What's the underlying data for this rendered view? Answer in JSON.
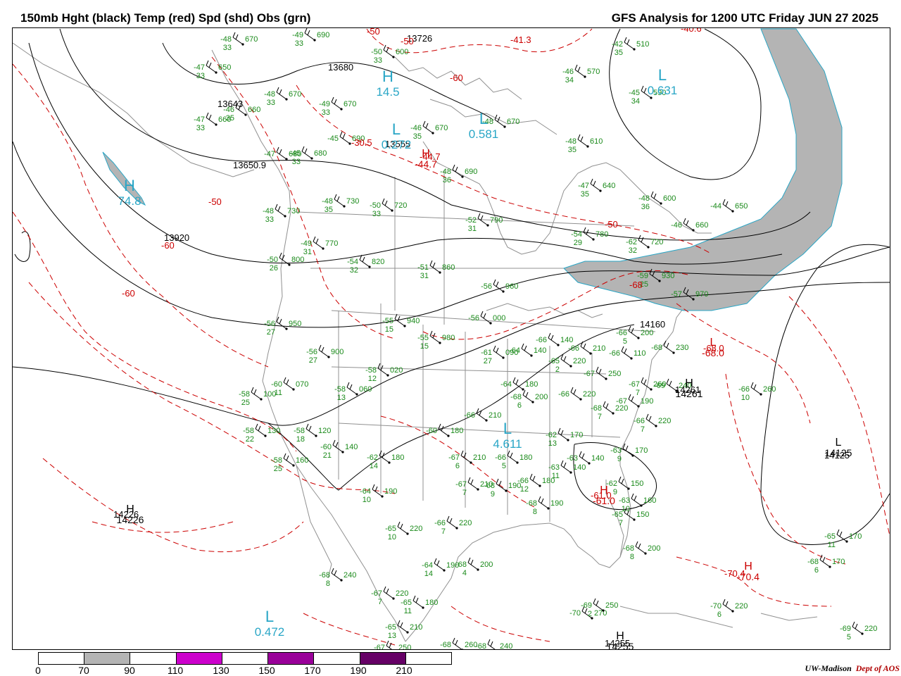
{
  "header": {
    "title_left": "150mb Hght (black) Temp (red) Spd (shd) Obs (grn)",
    "title_right": "GFS Analysis for 1200 UTC Friday  JUN 27 2025"
  },
  "colors": {
    "height_contour": "#000000",
    "temperature_contour": "#cc0000",
    "speed_shading": "#b4b4b4",
    "observation": "#1a8a1a",
    "high_low_marker": "#29a6c6",
    "geography": "#909090"
  },
  "height_labels": [
    "13726",
    "13680",
    "13643",
    "13555",
    "13650.9",
    "13920",
    "14226",
    "14261",
    "14160",
    "14125",
    "14255"
  ],
  "temperature_labels": [
    "-50",
    "-50",
    "-50",
    "-50",
    "-60",
    "-60",
    "-60",
    "-68",
    "-68.0",
    "-61.0",
    "-70.4",
    "-40.6",
    "-41.3",
    "-44.7",
    "-30.5"
  ],
  "pressure_centers": [
    {
      "letter": "H",
      "value": "14.5",
      "color": "cyan"
    },
    {
      "letter": "L",
      "value": "0.631",
      "color": "cyan"
    },
    {
      "letter": "L",
      "value": "0.272",
      "color": "cyan"
    },
    {
      "letter": "L",
      "value": "0.581",
      "color": "cyan"
    },
    {
      "letter": "H",
      "value": "74.8",
      "color": "cyan"
    },
    {
      "letter": "L",
      "value": "4.611",
      "color": "cyan"
    },
    {
      "letter": "L",
      "value": "0.472",
      "color": "cyan"
    },
    {
      "letter": "H",
      "value": "14226",
      "color": "black"
    },
    {
      "letter": "H",
      "value": "14261",
      "color": "black"
    },
    {
      "letter": "L",
      "value": "14125",
      "color": "black"
    },
    {
      "letter": "H",
      "value": "14255",
      "color": "black"
    },
    {
      "letter": "H",
      "value": "-61.0",
      "color": "red"
    },
    {
      "letter": "H",
      "value": "-44.7",
      "color": "red"
    },
    {
      "letter": "L",
      "value": "-68.0",
      "color": "red"
    },
    {
      "letter": "H",
      "value": "-70.4",
      "color": "red"
    }
  ],
  "observations": [
    {
      "t": "-48",
      "h": "670",
      "d": "33"
    },
    {
      "t": "-49",
      "h": "690",
      "d": "33"
    },
    {
      "t": "-47",
      "h": "650",
      "d": "33"
    },
    {
      "t": "-48",
      "h": "670",
      "d": "33"
    },
    {
      "t": "-46",
      "h": "660",
      "d": "35"
    },
    {
      "t": "-47",
      "h": "660",
      "d": "33"
    },
    {
      "t": "-49",
      "h": "670",
      "d": "33"
    },
    {
      "t": "-46",
      "h": "670",
      "d": "35"
    },
    {
      "t": "-48",
      "h": "670",
      "d": ""
    },
    {
      "t": "-48",
      "h": "690",
      "d": "36"
    },
    {
      "t": "-48",
      "h": "730",
      "d": "35"
    },
    {
      "t": "-50",
      "h": "720",
      "d": "33"
    },
    {
      "t": "-48",
      "h": "730",
      "d": "33"
    },
    {
      "t": "-49",
      "h": "770",
      "d": "31"
    },
    {
      "t": "-50",
      "h": "800",
      "d": "26"
    },
    {
      "t": "-54",
      "h": "820",
      "d": "32"
    },
    {
      "t": "-51",
      "h": "860",
      "d": "31"
    },
    {
      "t": "-56",
      "h": "960",
      "d": ""
    },
    {
      "t": "-56",
      "h": "000",
      "d": ""
    },
    {
      "t": "-55",
      "h": "980",
      "d": "15"
    },
    {
      "t": "-55",
      "h": "940",
      "d": "15"
    },
    {
      "t": "-56",
      "h": "950",
      "d": "27"
    },
    {
      "t": "-56",
      "h": "900",
      "d": "27"
    },
    {
      "t": "-58",
      "h": "020",
      "d": "12"
    },
    {
      "t": "-58",
      "h": "060",
      "d": "13"
    },
    {
      "t": "-60",
      "h": "070",
      "d": "11"
    },
    {
      "t": "-58",
      "h": "100",
      "d": "25"
    },
    {
      "t": "-58",
      "h": "130",
      "d": "22"
    },
    {
      "t": "-58",
      "h": "120",
      "d": "18"
    },
    {
      "t": "-60",
      "h": "140",
      "d": "21"
    },
    {
      "t": "-58",
      "h": "160",
      "d": "25"
    },
    {
      "t": "-62",
      "h": "180",
      "d": "14"
    },
    {
      "t": "-64",
      "h": "190",
      "d": "10"
    },
    {
      "t": "-60",
      "h": "180",
      "d": ""
    },
    {
      "t": "-66",
      "h": "210",
      "d": ""
    },
    {
      "t": "-67",
      "h": "210",
      "d": "6"
    },
    {
      "t": "-67",
      "h": "210",
      "d": "7"
    },
    {
      "t": "-68",
      "h": "190",
      "d": "9"
    },
    {
      "t": "-66",
      "h": "180",
      "d": "5"
    },
    {
      "t": "-66",
      "h": "180",
      "d": "12"
    },
    {
      "t": "-64",
      "h": "180",
      "d": ""
    },
    {
      "t": "-68",
      "h": "200",
      "d": "6"
    },
    {
      "t": "-65",
      "h": "220",
      "d": "10"
    },
    {
      "t": "-66",
      "h": "220",
      "d": "7"
    },
    {
      "t": "-64",
      "h": "190",
      "d": "14"
    },
    {
      "t": "-68",
      "h": "200",
      "d": "4"
    },
    {
      "t": "-68",
      "h": "240",
      "d": "8"
    },
    {
      "t": "-67",
      "h": "220",
      "d": "7"
    },
    {
      "t": "-65",
      "h": "180",
      "d": "11"
    },
    {
      "t": "-65",
      "h": "210",
      "d": "13"
    },
    {
      "t": "-67",
      "h": "250",
      "d": ""
    },
    {
      "t": "-68",
      "h": "260",
      "d": ""
    },
    {
      "t": "-68",
      "h": "240",
      "d": ""
    },
    {
      "t": "-61",
      "h": "090",
      "d": "27"
    },
    {
      "t": "-64",
      "h": "140",
      "d": ""
    },
    {
      "t": "-66",
      "h": "140",
      "d": ""
    },
    {
      "t": "-65",
      "h": "220",
      "d": "2"
    },
    {
      "t": "-66",
      "h": "210",
      "d": ""
    },
    {
      "t": "-67",
      "h": "250",
      "d": ""
    },
    {
      "t": "-66",
      "h": "220",
      "d": ""
    },
    {
      "t": "-68",
      "h": "220",
      "d": "7"
    },
    {
      "t": "-67",
      "h": "260",
      "d": "7"
    },
    {
      "t": "-69",
      "h": "240",
      "d": ""
    },
    {
      "t": "-66",
      "h": "200",
      "d": "5"
    },
    {
      "t": "-66",
      "h": "110",
      "d": ""
    },
    {
      "t": "-68",
      "h": "230",
      "d": ""
    },
    {
      "t": "-62",
      "h": "170",
      "d": "13"
    },
    {
      "t": "-63",
      "h": "140",
      "d": "11"
    },
    {
      "t": "-63",
      "h": "140",
      "d": ""
    },
    {
      "t": "-63",
      "h": "170",
      "d": "9"
    },
    {
      "t": "-62",
      "h": "150",
      "d": "9"
    },
    {
      "t": "-63",
      "h": "160",
      "d": "10"
    },
    {
      "t": "-65",
      "h": "150",
      "d": "7"
    },
    {
      "t": "-68",
      "h": "190",
      "d": "8"
    },
    {
      "t": "-68",
      "h": "200",
      "d": "8"
    },
    {
      "t": "-70",
      "h": "270",
      "d": ""
    },
    {
      "t": "-69",
      "h": "250",
      "d": "2"
    },
    {
      "t": "-66",
      "h": "260",
      "d": "10"
    },
    {
      "t": "-68",
      "h": "170",
      "d": "6"
    },
    {
      "t": "-70",
      "h": "220",
      "d": "6"
    },
    {
      "t": "-69",
      "h": "220",
      "d": "5"
    },
    {
      "t": "-65",
      "h": "170",
      "d": "11"
    },
    {
      "t": "-66",
      "h": "220",
      "d": "7"
    },
    {
      "t": "-67",
      "h": "190",
      "d": ""
    },
    {
      "t": "-42",
      "h": "510",
      "d": "35"
    },
    {
      "t": "-46",
      "h": "570",
      "d": "34"
    },
    {
      "t": "-45",
      "h": "590",
      "d": "34"
    },
    {
      "t": "-48",
      "h": "610",
      "d": "35"
    },
    {
      "t": "-47",
      "h": "640",
      "d": "35"
    },
    {
      "t": "-48",
      "h": "600",
      "d": "36"
    },
    {
      "t": "-44",
      "h": "650",
      "d": ""
    },
    {
      "t": "-46",
      "h": "660",
      "d": ""
    },
    {
      "t": "-54",
      "h": "780",
      "d": "29"
    },
    {
      "t": "-52",
      "h": "790",
      "d": "31"
    },
    {
      "t": "-62",
      "h": "720",
      "d": "32"
    },
    {
      "t": "-50",
      "h": "600",
      "d": "33"
    },
    {
      "t": "-45",
      "h": "690",
      "d": ""
    },
    {
      "t": "-45",
      "h": "680",
      "d": "33"
    },
    {
      "t": "-47",
      "h": "680",
      "d": ""
    },
    {
      "t": "-59",
      "h": "930",
      "d": "25"
    },
    {
      "t": "-57",
      "h": "970",
      "d": ""
    }
  ],
  "legend": {
    "labels": [
      "0",
      "70",
      "90",
      "110",
      "130",
      "150",
      "170",
      "190",
      "210"
    ],
    "colors": [
      "#ffffff",
      "#b4b4b4",
      "#ffffff",
      "#cc00cc",
      "#ffffff",
      "#990099",
      "#ffffff",
      "#660066",
      "#ffffff"
    ]
  },
  "credit": {
    "org": "UW-Madison",
    "dept": "Dept of AOS"
  }
}
